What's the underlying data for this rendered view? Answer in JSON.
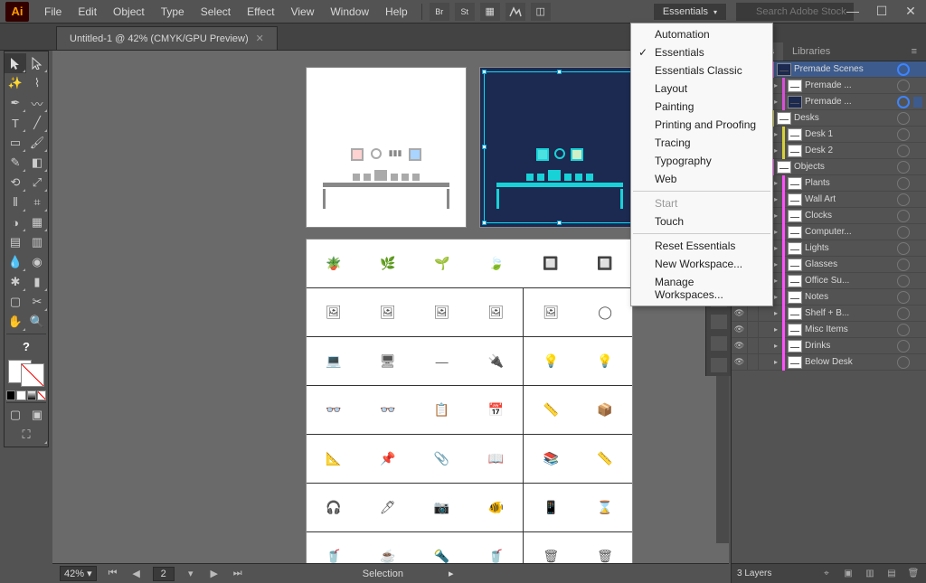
{
  "app": {
    "badge": "Ai"
  },
  "menubar": {
    "items": [
      "File",
      "Edit",
      "Object",
      "Type",
      "Select",
      "Effect",
      "View",
      "Window",
      "Help"
    ]
  },
  "workspace": {
    "label": "Essentials",
    "menu": [
      {
        "label": "Automation"
      },
      {
        "label": "Essentials",
        "checked": true
      },
      {
        "label": "Essentials Classic"
      },
      {
        "label": "Layout"
      },
      {
        "label": "Painting"
      },
      {
        "label": "Printing and Proofing"
      },
      {
        "label": "Tracing"
      },
      {
        "label": "Typography"
      },
      {
        "label": "Web"
      },
      {
        "sep": true
      },
      {
        "label": "Start",
        "disabled": true
      },
      {
        "label": "Touch"
      },
      {
        "sep": true
      },
      {
        "label": "Reset Essentials"
      },
      {
        "label": "New Workspace..."
      },
      {
        "label": "Manage Workspaces..."
      }
    ]
  },
  "search": {
    "placeholder": "Search Adobe Stock"
  },
  "document": {
    "tab_title": "Untitled-1 @ 42% (CMYK/GPU Preview)"
  },
  "status": {
    "zoom": "42%",
    "artboard_num": "2",
    "selection_info": "Selection"
  },
  "panels": {
    "tabs": [
      "Layers",
      "Libraries"
    ],
    "active_tab": "Layers",
    "layer_count_label": "3 Layers",
    "layers": [
      {
        "name": "Premade Scenes",
        "color": "#d94fd9",
        "expanded": true,
        "selected": true,
        "target": true,
        "thumb": "dark",
        "children": [
          {
            "name": "Premade ...",
            "color": "#d94fd9",
            "thumb": "light"
          },
          {
            "name": "Premade ...",
            "color": "#d94fd9",
            "thumb": "dark",
            "target": true,
            "sel": true
          }
        ]
      },
      {
        "name": "Desks",
        "color": "#d6d03a",
        "expanded": true,
        "children": [
          {
            "name": "Desk 1",
            "color": "#d6d03a"
          },
          {
            "name": "Desk 2",
            "color": "#d6d03a"
          }
        ]
      },
      {
        "name": "Objects",
        "color": "#ff4fff",
        "expanded": true,
        "children": [
          {
            "name": "Plants",
            "color": "#ff4fff"
          },
          {
            "name": "Wall Art",
            "color": "#ff4fff"
          },
          {
            "name": "Clocks",
            "color": "#ff4fff"
          },
          {
            "name": "Computer...",
            "color": "#ff4fff"
          },
          {
            "name": "Lights",
            "color": "#ff4fff"
          },
          {
            "name": "Glasses",
            "color": "#ff4fff"
          },
          {
            "name": "Office Su...",
            "color": "#ff4fff"
          },
          {
            "name": "Notes",
            "color": "#ff4fff"
          },
          {
            "name": "Shelf + B...",
            "color": "#ff4fff"
          },
          {
            "name": "Misc Items",
            "color": "#ff4fff"
          },
          {
            "name": "Drinks",
            "color": "#ff4fff"
          },
          {
            "name": "Below Desk",
            "color": "#ff4fff"
          }
        ]
      }
    ]
  },
  "artboards": {
    "catalog_rows": [
      [
        "🪴",
        "🌿",
        "🌱",
        "🍃",
        "🔲",
        "🔲"
      ],
      [
        "🖼",
        "🖼",
        "🖼",
        "🖼",
        "🖼",
        "◯"
      ],
      [
        "💻",
        "🖥",
        "—",
        "🔌",
        "💡",
        "💡"
      ],
      [
        "👓",
        "👓",
        "📋",
        "📅",
        "📏",
        "📦"
      ],
      [
        "📐",
        "📌",
        "📎",
        "📖",
        "📚",
        "📏"
      ],
      [
        "🎧",
        "🖊",
        "📷",
        "🐠",
        "📱",
        "⌛"
      ],
      [
        "🥤",
        "☕",
        "🔦",
        "🥤",
        "🗑",
        "🗑"
      ]
    ]
  }
}
